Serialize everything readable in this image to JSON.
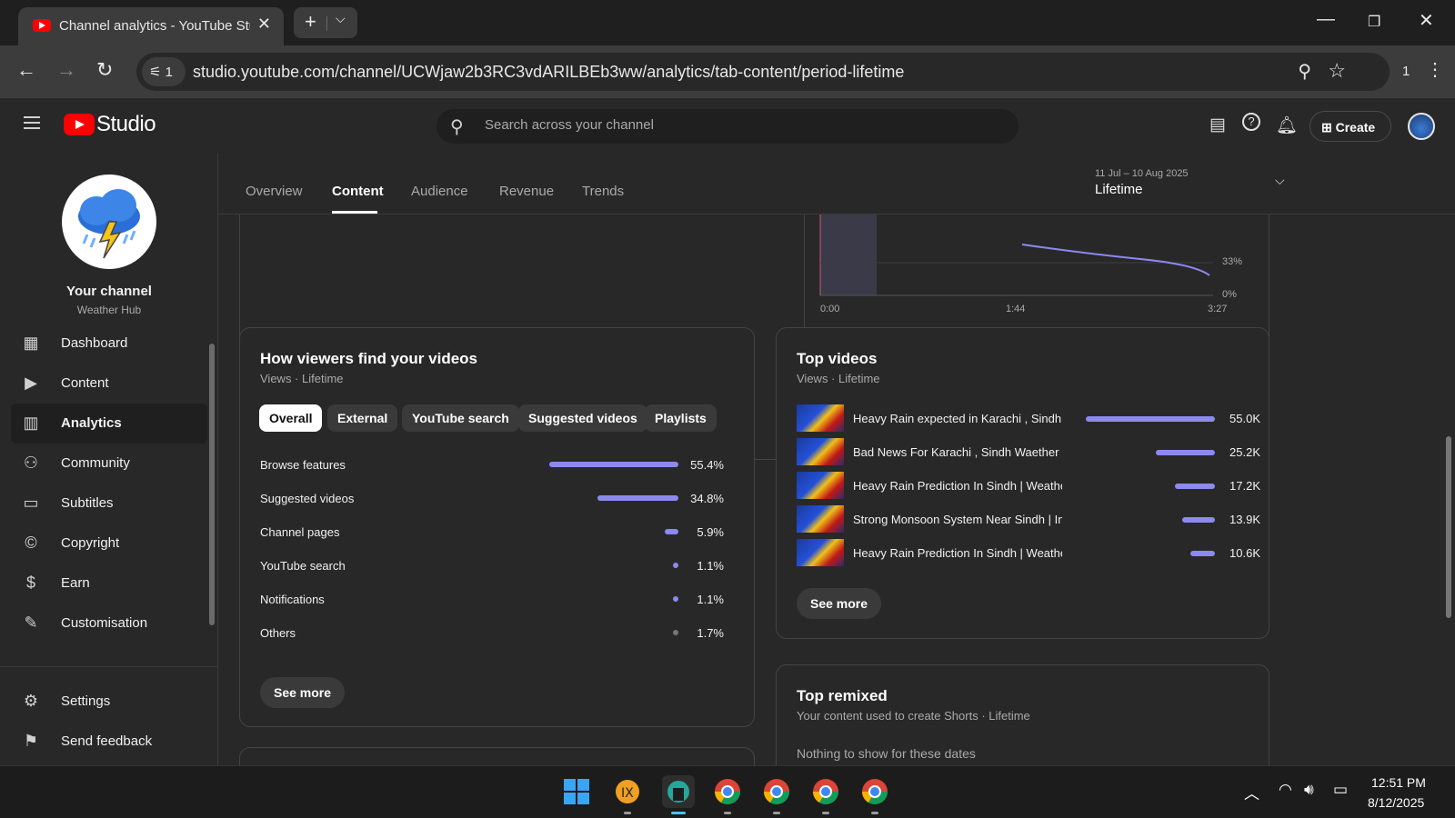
{
  "browser": {
    "tab_title": "Channel analytics - YouTube Studio",
    "url": "studio.youtube.com/channel/UCWjaw2b3RC3vdARILBEb3ww/analytics/tab-content/period-lifetime",
    "site_info_count": "1",
    "extensions_count": "1"
  },
  "header": {
    "logo_text": "Studio",
    "search_placeholder": "Search across your channel",
    "create_label": "Create"
  },
  "sidebar": {
    "channel_name": "Your channel",
    "channel_handle": "Weather Hub",
    "items": [
      {
        "label": "Dashboard",
        "icon": "dashboard-icon"
      },
      {
        "label": "Content",
        "icon": "content-icon"
      },
      {
        "label": "Analytics",
        "icon": "analytics-icon",
        "active": true
      },
      {
        "label": "Community",
        "icon": "community-icon"
      },
      {
        "label": "Subtitles",
        "icon": "subtitles-icon"
      },
      {
        "label": "Copyright",
        "icon": "copyright-icon"
      },
      {
        "label": "Earn",
        "icon": "earn-icon"
      },
      {
        "label": "Customisation",
        "icon": "customisation-icon"
      }
    ],
    "bottom_items": [
      {
        "label": "Settings",
        "icon": "settings-icon"
      },
      {
        "label": "Send feedback",
        "icon": "feedback-icon"
      }
    ]
  },
  "analytics": {
    "tabs": [
      "Overview",
      "Content",
      "Audience",
      "Revenue",
      "Trends"
    ],
    "active_tab": "Content",
    "date_range": "11 Jul – 10 Aug 2025",
    "period": "Lifetime"
  },
  "retention_chart": {
    "y_ticks": [
      "33%",
      "0%"
    ],
    "x_ticks": [
      "0:00",
      "1:44",
      "3:27"
    ]
  },
  "traffic_sources": {
    "title": "How viewers find your videos",
    "subtitle": "Views · Lifetime",
    "chips": [
      "Overall",
      "External",
      "YouTube search",
      "Suggested videos",
      "Playlists"
    ],
    "active_chip": "Overall",
    "rows": [
      {
        "label": "Browse features",
        "value": "55.4%",
        "fraction": 0.554
      },
      {
        "label": "Suggested videos",
        "value": "34.8%",
        "fraction": 0.348
      },
      {
        "label": "Channel pages",
        "value": "5.9%",
        "fraction": 0.059
      },
      {
        "label": "YouTube search",
        "value": "1.1%",
        "fraction": 0.011
      },
      {
        "label": "Notifications",
        "value": "1.1%",
        "fraction": 0.011
      },
      {
        "label": "Others",
        "value": "1.7%",
        "fraction": 0.017
      }
    ],
    "see_more_label": "See more"
  },
  "top_videos": {
    "title": "Top videos",
    "subtitle": "Views · Lifetime",
    "rows": [
      {
        "title": "Heavy Rain expected in Karachi , Sindh | ...",
        "value": "55.0K",
        "views": 55000
      },
      {
        "title": "Bad News For Karachi , Sindh Waether | ...",
        "value": "25.2K",
        "views": 25200
      },
      {
        "title": "Heavy Rain Prediction In Sindh | Weather ...",
        "value": "17.2K",
        "views": 17200
      },
      {
        "title": "Strong Monsoon System Near Sindh | Int...",
        "value": "13.9K",
        "views": 13900
      },
      {
        "title": "Heavy Rain Prediction In Sindh | Weather ...",
        "value": "10.6K",
        "views": 10600
      }
    ],
    "see_more_label": "See more"
  },
  "top_remixed": {
    "title": "Top remixed",
    "subtitle": "Your content used to create Shorts · Lifetime",
    "empty_text": "Nothing to show for these dates"
  },
  "colors": {
    "accent_bar": "#8c89f0",
    "background": "#282828",
    "brand_red": "#ff0000"
  },
  "taskbar": {
    "time": "12:51 PM",
    "date": "8/12/2025"
  }
}
